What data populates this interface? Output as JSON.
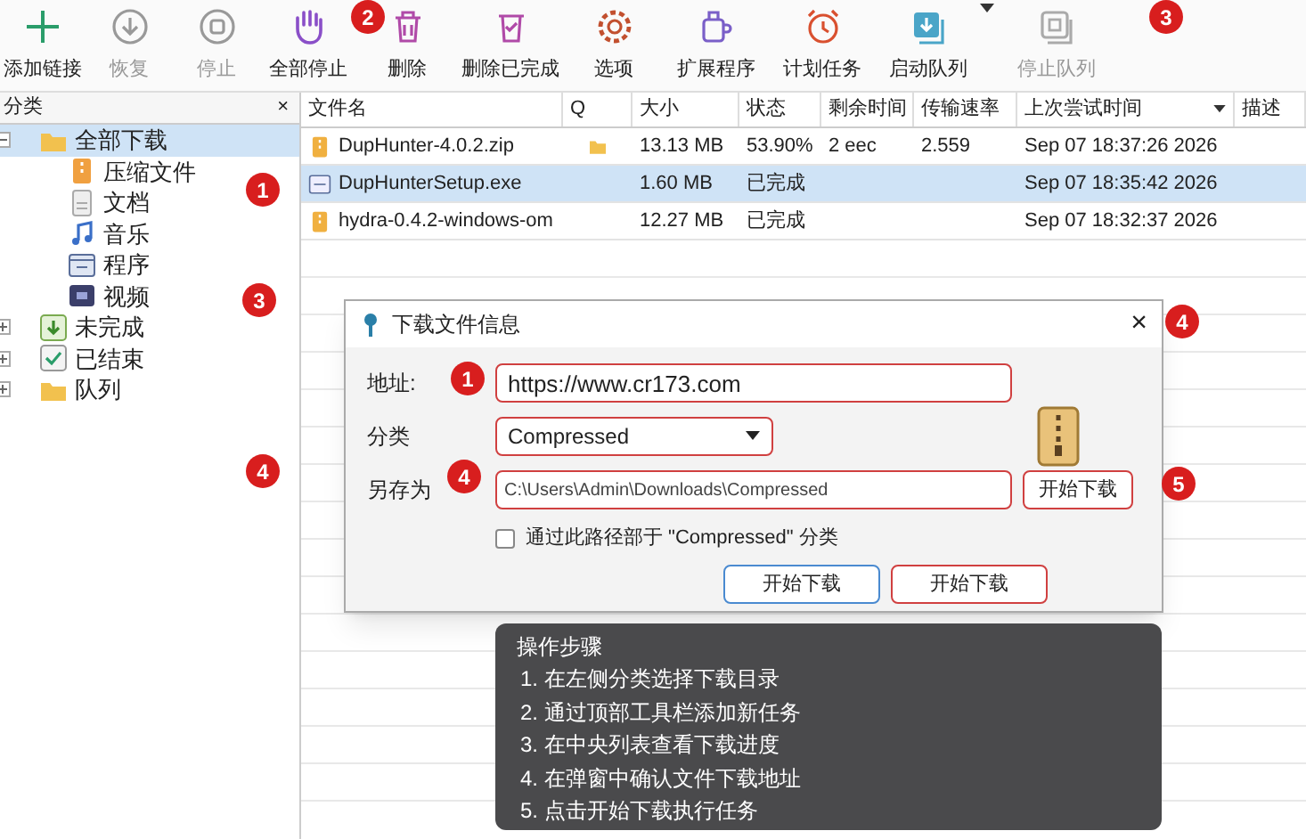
{
  "toolbar": [
    {
      "kind": "add",
      "label": "添加链接",
      "disabled": false
    },
    {
      "kind": "resume",
      "label": "恢复",
      "disabled": true
    },
    {
      "kind": "stop",
      "label": "停止",
      "disabled": true
    },
    {
      "kind": "stopall",
      "label": "全部停止",
      "disabled": false
    },
    {
      "kind": "delete",
      "label": "删除",
      "disabled": false
    },
    {
      "kind": "clear",
      "label": "删除已完成",
      "disabled": false
    },
    {
      "kind": "options",
      "label": "选项",
      "disabled": false
    },
    {
      "kind": "extensions",
      "label": "扩展程序",
      "disabled": false
    },
    {
      "kind": "scheduler",
      "label": "计划任务",
      "disabled": false
    },
    {
      "kind": "startqueue",
      "label": "启动队列",
      "disabled": false
    },
    {
      "kind": "stopqueue",
      "label": "停止队列",
      "disabled": true
    }
  ],
  "sidebar": {
    "title": "分类",
    "close": "×",
    "items": [
      {
        "kind": "folder",
        "label": "全部下载",
        "selected": true,
        "expanded": true,
        "children": [
          {
            "kind": "zip",
            "label": "压缩文件",
            "selected": false
          },
          {
            "kind": "doc",
            "label": "文档",
            "selected": false
          },
          {
            "kind": "music",
            "label": "音乐",
            "selected": false
          },
          {
            "kind": "program",
            "label": "程序",
            "selected": false
          },
          {
            "kind": "video",
            "label": "视频",
            "selected": false
          }
        ]
      },
      {
        "kind": "unfinished",
        "label": "未完成",
        "selected": false,
        "expanded": false
      },
      {
        "kind": "finished",
        "label": "已结束",
        "selected": false,
        "expanded": false
      },
      {
        "kind": "queue",
        "label": "队列",
        "selected": false,
        "expanded": false
      }
    ]
  },
  "table": {
    "columns": [
      "文件名",
      "Q",
      "大小",
      "状态",
      "剩余时间",
      "传输速率",
      "上次尝试时间",
      "描述"
    ],
    "rows": [
      {
        "kind": "zip",
        "selected": false,
        "queued": true,
        "cells": [
          "DupHunter-4.0.2.zip",
          "",
          "13.13 MB",
          "53.90%",
          "2 eec",
          "2.559",
          "Sep 07 18:37:26 2026",
          ""
        ]
      },
      {
        "kind": "exe",
        "selected": true,
        "queued": false,
        "cells": [
          "DupHunterSetup.exe",
          "",
          "1.60 MB",
          "已完成",
          "",
          "",
          "Sep 07 18:35:42 2026",
          ""
        ]
      },
      {
        "kind": "zip",
        "selected": false,
        "queued": false,
        "cells": [
          "hydra-0.4.2-windows-om",
          "",
          "12.27 MB",
          "已完成",
          "",
          "",
          "Sep 07 18:32:37 2026",
          ""
        ]
      }
    ]
  },
  "dialog": {
    "title": "下载文件信息",
    "close": "×",
    "url_label": "地址:",
    "url": "https://www.cr173.com",
    "category_label": "分类",
    "category": "Compressed",
    "save_label": "另存为",
    "save_path": "C:\\Users\\Admin\\Downloads\\Compressed",
    "remember_label": "通过此路径部于 \"Compressed\" 分类",
    "remember_checked": false,
    "side_button": "开始下载",
    "buttons": [
      "开始下载",
      "开始下载"
    ]
  },
  "steps": {
    "title": "操作步骤",
    "items": [
      "1.  在左侧分类选择下载目录",
      "2.  通过顶部工具栏添加新任务",
      "3.  在中央列表查看下载进度",
      "4.  在弹窗中确认文件下载地址",
      "5.  点击开始下载执行任务"
    ]
  },
  "callouts": [
    "2",
    "3",
    "1",
    "3",
    "4",
    "4",
    "1",
    "4",
    "5"
  ]
}
